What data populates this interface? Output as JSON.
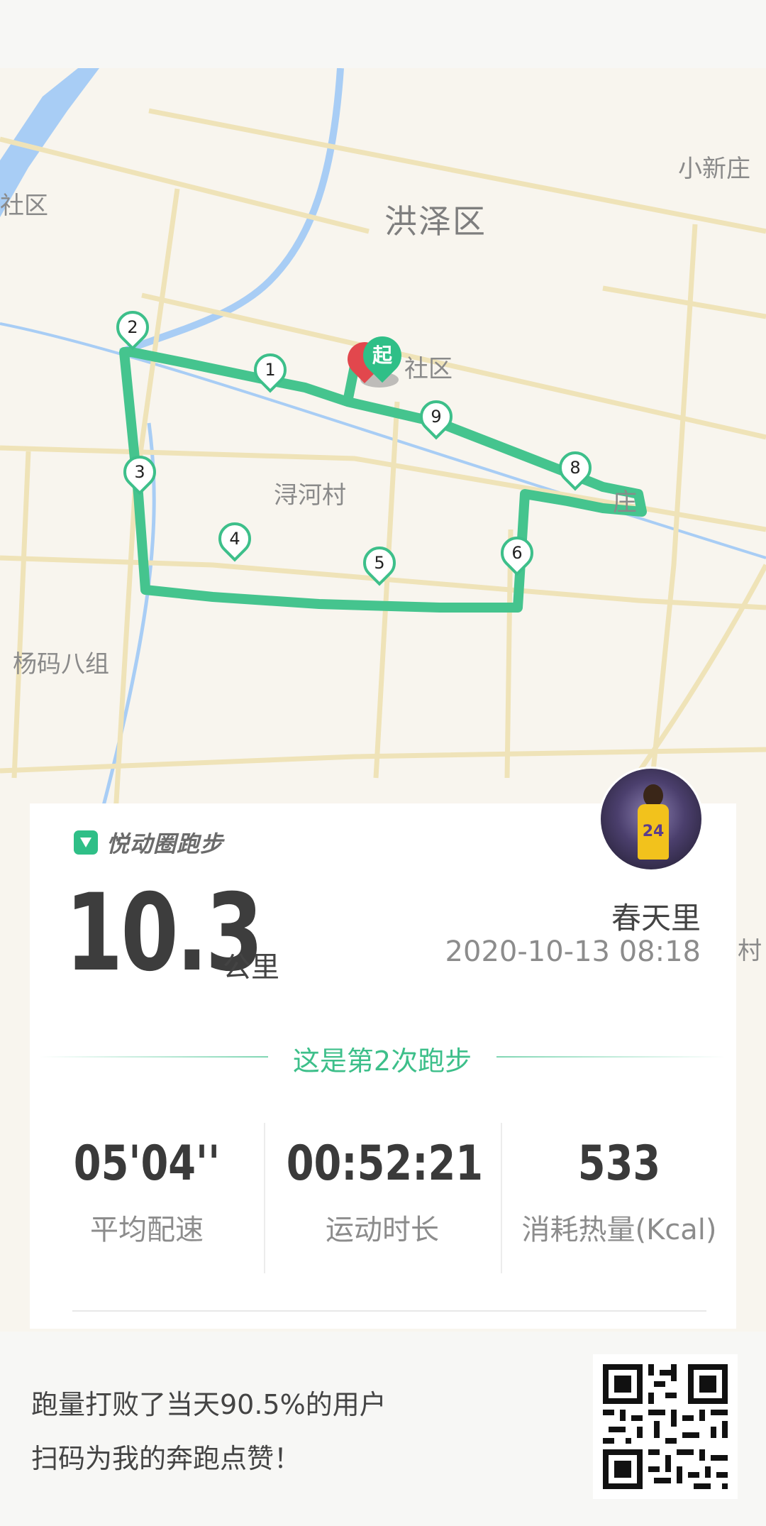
{
  "map": {
    "labels": {
      "district": "洪泽区",
      "xiaoxinzhuang": "小新庄",
      "shequ_left": "社区",
      "shequ_center": "社区",
      "xunhecun": "浔河村",
      "yangma": "杨码八组",
      "zhuang": "庄",
      "cun_right": "村"
    },
    "start_label": "起",
    "markers": [
      "1",
      "2",
      "3",
      "4",
      "5",
      "6",
      "8",
      "9"
    ]
  },
  "app": {
    "brand": "悦动圈跑步"
  },
  "run": {
    "distance": "10.3",
    "unit": "公里",
    "user": "春天里",
    "datetime": "2020-10-13 08:18",
    "count_text": "这是第2次跑步"
  },
  "stats": [
    {
      "value": "05'04''",
      "label": "平均配速"
    },
    {
      "value": "00:52:21",
      "label": "运动时长"
    },
    {
      "value": "533",
      "label": "消耗热量(Kcal)"
    }
  ],
  "footer": {
    "line1": "跑量打败了当天90.5%的用户",
    "line2": "扫码为我的奔跑点赞！"
  },
  "avatar": {
    "jersey_number": "24"
  },
  "colors": {
    "accent": "#2fbf87",
    "route": "#45c48e",
    "start_red": "#e2474d"
  }
}
